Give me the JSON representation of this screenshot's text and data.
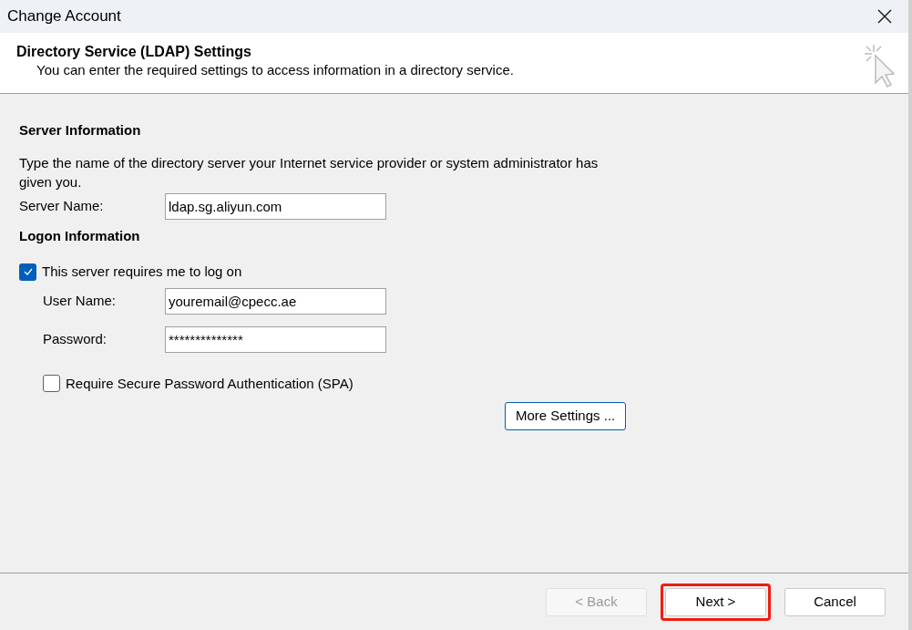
{
  "window": {
    "title": "Change Account"
  },
  "header": {
    "title": "Directory Service (LDAP) Settings",
    "subtitle": "You can enter the required settings to access information in a directory service."
  },
  "server_section": {
    "heading": "Server Information",
    "description": "Type the name of the directory server your Internet service provider or system administrator has given you.",
    "field": {
      "label": "Server Name:",
      "value": "ldap.sg.aliyun.com"
    }
  },
  "logon_section": {
    "heading": "Logon Information",
    "requires_logon": {
      "label": "This server requires me to log on",
      "checked": true
    },
    "fields": [
      {
        "label": "User Name:",
        "value": "youremail@cpecc.ae"
      },
      {
        "label": "Password:",
        "value": "**************"
      }
    ],
    "spa": {
      "label": "Require Secure Password Authentication (SPA)",
      "checked": false
    }
  },
  "more_settings": "More Settings ...",
  "buttons": [
    {
      "label": "< Back",
      "disabled": true,
      "highlighted": false
    },
    {
      "label": "Next >",
      "disabled": false,
      "highlighted": true
    },
    {
      "label": "Cancel",
      "disabled": false,
      "highlighted": false
    }
  ]
}
